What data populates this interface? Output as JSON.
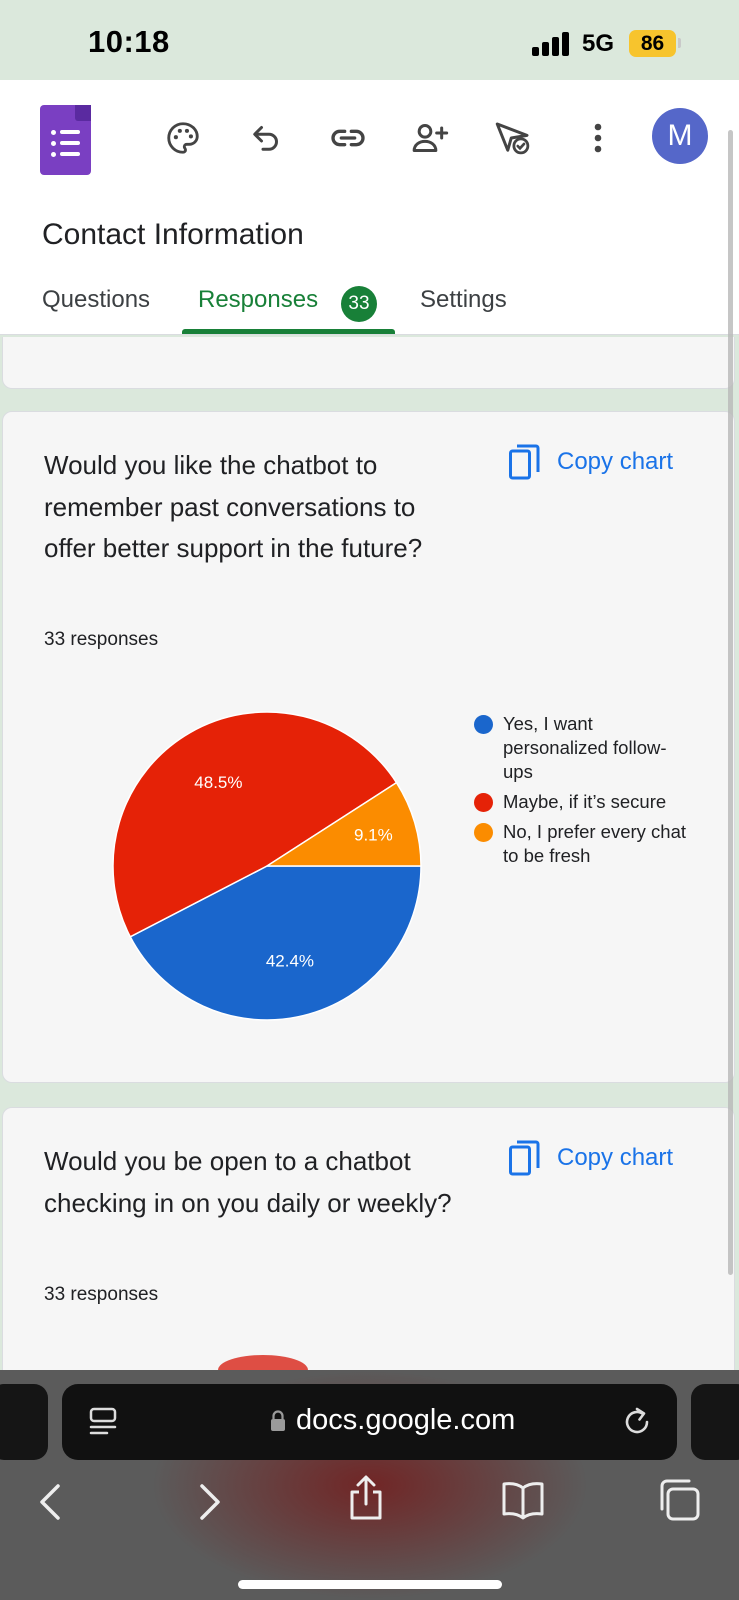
{
  "status_bar": {
    "time": "10:18",
    "network": "5G",
    "battery": "86"
  },
  "header": {
    "form_title": "Contact Information",
    "avatar_letter": "M",
    "icons": [
      "forms-logo-icon",
      "palette-icon",
      "undo-icon",
      "link-icon",
      "add-collaborator-icon",
      "send-icon",
      "more-icon"
    ]
  },
  "tabs": [
    {
      "label": "Questions",
      "active": false
    },
    {
      "label": "Responses",
      "active": true,
      "badge": "33"
    },
    {
      "label": "Settings",
      "active": false
    }
  ],
  "cards": [
    {
      "question": "Would you like the chatbot to remember past conversations to offer better support in the future?",
      "responses": "33 responses",
      "copy_label": "Copy chart",
      "chart_data": {
        "type": "pie",
        "slices": [
          {
            "label": "Yes, I want personalized follow-ups",
            "value": 42.4,
            "display": "42.4%",
            "color": "#1a66cc"
          },
          {
            "label": "Maybe, if it’s secure",
            "value": 48.5,
            "display": "48.5%",
            "color": "#e52207"
          },
          {
            "label": "No, I prefer every chat to be fresh",
            "value": 9.1,
            "display": "9.1%",
            "color": "#fb8c00"
          }
        ],
        "legend_position": "right"
      }
    },
    {
      "question": "Would you be open to a chatbot checking in on you daily or weekly?",
      "responses": "33 responses",
      "copy_label": "Copy chart"
    }
  ],
  "browser": {
    "url": "docs.google.com",
    "icons": [
      "reader-icon",
      "lock-icon",
      "reload-icon",
      "back-icon",
      "forward-icon",
      "share-icon",
      "bookmarks-icon",
      "tabs-icon"
    ]
  }
}
